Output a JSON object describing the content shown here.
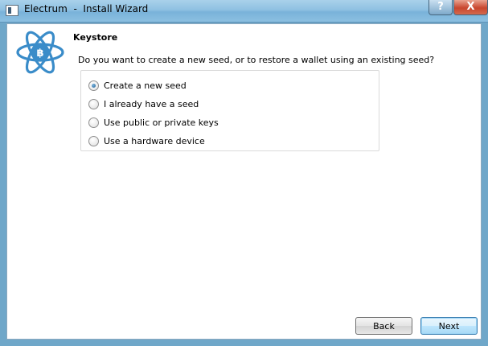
{
  "window": {
    "app_name": "Electrum",
    "title": "Electrum  -  Install Wizard",
    "help_glyph": "?",
    "close_glyph": "X"
  },
  "wizard": {
    "heading": "Keystore",
    "question": "Do you want to create a new seed, or to restore a wallet using an existing seed?",
    "options": [
      {
        "label": "Create a new seed",
        "selected": true
      },
      {
        "label": "I already have a seed",
        "selected": false
      },
      {
        "label": "Use public or private keys",
        "selected": false
      },
      {
        "label": "Use a hardware device",
        "selected": false
      }
    ]
  },
  "buttons": {
    "back": "Back",
    "next": "Next"
  },
  "icons": {
    "app": "electrum-app-icon",
    "logo": "electrum-bitcoin-atom-logo"
  },
  "colors": {
    "logo_blue": "#3a8cc9",
    "titlebar": "#8fc1e2",
    "close_red": "#c8462e"
  }
}
